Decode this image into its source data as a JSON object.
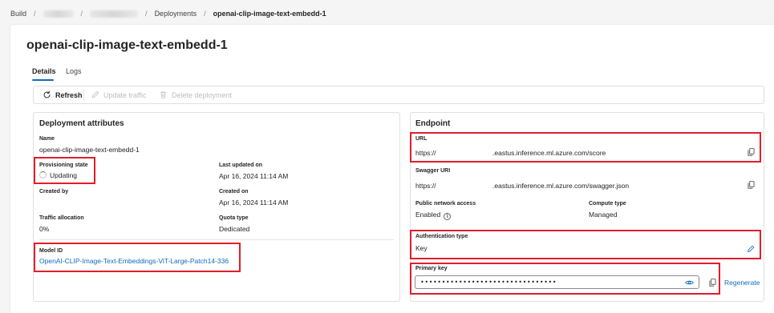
{
  "breadcrumb": {
    "items": [
      "Build",
      "Deployments"
    ],
    "current": "openai-clip-image-text-embedd-1"
  },
  "page": {
    "title": "openai-clip-image-text-embedd-1"
  },
  "tabs": [
    {
      "label": "Details",
      "active": true
    },
    {
      "label": "Logs",
      "active": false
    }
  ],
  "toolbar": {
    "refresh": "Refresh",
    "update_traffic": "Update traffic",
    "delete_deployment": "Delete deployment"
  },
  "deployment": {
    "heading": "Deployment attributes",
    "name_label": "Name",
    "name_value": "openai-clip-image-text-embedd-1",
    "provisioning_label": "Provisioning state",
    "provisioning_value": "Updating",
    "last_updated_label": "Last updated on",
    "last_updated_value": "Apr 16, 2024 11:14 AM",
    "created_by_label": "Created by",
    "created_on_label": "Created on",
    "created_on_value": "Apr 16, 2024 11:14 AM",
    "traffic_label": "Traffic allocation",
    "traffic_value": "0%",
    "quota_label": "Quota type",
    "quota_value": "Dedicated",
    "model_label": "Model ID",
    "model_value": "OpenAI-CLIP-Image-Text-Embeddings-ViT-Large-Patch14-336"
  },
  "endpoint": {
    "heading": "Endpoint",
    "url_label": "URL",
    "url_prefix": "https://",
    "url_suffix": ".eastus.inference.ml.azure.com/score",
    "swagger_label": "Swagger URI",
    "swagger_prefix": "https://",
    "swagger_suffix": ".eastus.inference.ml.azure.com/swagger.json",
    "public_access_label": "Public network access",
    "public_access_value": "Enabled",
    "compute_label": "Compute type",
    "compute_value": "Managed",
    "auth_label": "Authentication type",
    "auth_value": "Key",
    "primary_key_label": "Primary key",
    "primary_key_value": "••••••••••••••••••••••••••••••••",
    "regenerate": "Regenerate"
  },
  "colors": {
    "accent": "#0f6cbd",
    "highlight_box": "#e11d2a",
    "text": "#242424",
    "border": "#e0e0e0"
  },
  "icons": [
    "refresh-icon",
    "pencil-icon",
    "trash-icon",
    "info-icon",
    "copy-icon",
    "eye-icon",
    "edit-icon",
    "spinner-icon"
  ]
}
